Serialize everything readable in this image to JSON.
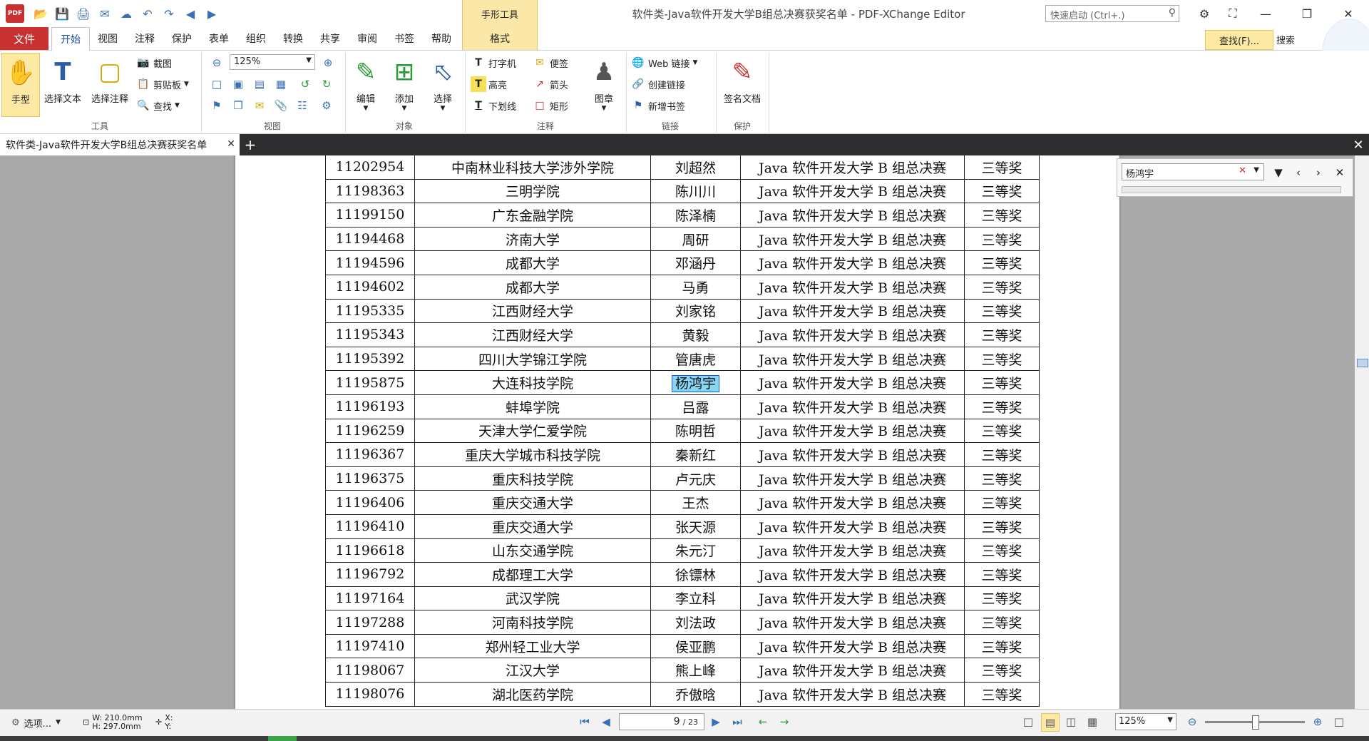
{
  "window": {
    "title": "软件类-Java软件开发大学B组总决赛获奖名单 - PDF-XChange Editor",
    "app_logo_text": "PDF",
    "quick_search_placeholder": "快速启动 (Ctrl+.)"
  },
  "context_tab": {
    "title": "手形工具",
    "tab": "格式"
  },
  "menu": {
    "file": "文件",
    "items": [
      "开始",
      "视图",
      "注释",
      "保护",
      "表单",
      "组织",
      "转换",
      "共享",
      "审阅",
      "书签",
      "帮助"
    ],
    "find_button": "查找(F)...",
    "search_button": "搜索"
  },
  "ribbon": {
    "tools": {
      "hand": "手型",
      "select_text": "选择文本",
      "select_annot": "选择注释",
      "snapshot": "截图",
      "clipboard": "剪贴板",
      "find": "查找",
      "label": "工具"
    },
    "view": {
      "zoom": "125%",
      "label": "视图"
    },
    "objects": {
      "edit": "编辑",
      "add": "添加",
      "select": "选择",
      "label": "对象"
    },
    "comments": {
      "typewriter": "打字机",
      "note": "便签",
      "highlight": "高亮",
      "arrow": "箭头",
      "underline": "下划线",
      "rect": "矩形",
      "stamp": "图章",
      "label": "注释"
    },
    "links": {
      "web": "Web 链接",
      "create": "创建链接",
      "bookmark": "新增书签",
      "label": "链接"
    },
    "protect": {
      "sign": "签名文档",
      "label": "保护"
    }
  },
  "doc_tab": {
    "title": "软件类-Java软件开发大学B组总决赛获奖名单"
  },
  "find_bar": {
    "query": "杨鸿宇"
  },
  "table": {
    "highlight_row": 9,
    "rows": [
      [
        "11202954",
        "中南林业科技大学涉外学院",
        "刘超然",
        "Java 软件开发大学 B 组总决赛",
        "三等奖"
      ],
      [
        "11198363",
        "三明学院",
        "陈川川",
        "Java 软件开发大学 B 组总决赛",
        "三等奖"
      ],
      [
        "11199150",
        "广东金融学院",
        "陈泽楠",
        "Java 软件开发大学 B 组总决赛",
        "三等奖"
      ],
      [
        "11194468",
        "济南大学",
        "周研",
        "Java 软件开发大学 B 组总决赛",
        "三等奖"
      ],
      [
        "11194596",
        "成都大学",
        "邓涵丹",
        "Java 软件开发大学 B 组总决赛",
        "三等奖"
      ],
      [
        "11194602",
        "成都大学",
        "马勇",
        "Java 软件开发大学 B 组总决赛",
        "三等奖"
      ],
      [
        "11195335",
        "江西财经大学",
        "刘家铭",
        "Java 软件开发大学 B 组总决赛",
        "三等奖"
      ],
      [
        "11195343",
        "江西财经大学",
        "黄毅",
        "Java 软件开发大学 B 组总决赛",
        "三等奖"
      ],
      [
        "11195392",
        "四川大学锦江学院",
        "管唐虎",
        "Java 软件开发大学 B 组总决赛",
        "三等奖"
      ],
      [
        "11195875",
        "大连科技学院",
        "杨鸿宇",
        "Java 软件开发大学 B 组总决赛",
        "三等奖"
      ],
      [
        "11196193",
        "蚌埠学院",
        "吕露",
        "Java 软件开发大学 B 组总决赛",
        "三等奖"
      ],
      [
        "11196259",
        "天津大学仁爱学院",
        "陈明哲",
        "Java 软件开发大学 B 组总决赛",
        "三等奖"
      ],
      [
        "11196367",
        "重庆大学城市科技学院",
        "秦新红",
        "Java 软件开发大学 B 组总决赛",
        "三等奖"
      ],
      [
        "11196375",
        "重庆科技学院",
        "卢元庆",
        "Java 软件开发大学 B 组总决赛",
        "三等奖"
      ],
      [
        "11196406",
        "重庆交通大学",
        "王杰",
        "Java 软件开发大学 B 组总决赛",
        "三等奖"
      ],
      [
        "11196410",
        "重庆交通大学",
        "张天源",
        "Java 软件开发大学 B 组总决赛",
        "三等奖"
      ],
      [
        "11196618",
        "山东交通学院",
        "朱元汀",
        "Java 软件开发大学 B 组总决赛",
        "三等奖"
      ],
      [
        "11196792",
        "成都理工大学",
        "徐镖林",
        "Java 软件开发大学 B 组总决赛",
        "三等奖"
      ],
      [
        "11197164",
        "武汉学院",
        "李立科",
        "Java 软件开发大学 B 组总决赛",
        "三等奖"
      ],
      [
        "11197288",
        "河南科技学院",
        "刘法政",
        "Java 软件开发大学 B 组总决赛",
        "三等奖"
      ],
      [
        "11197410",
        "郑州轻工业大学",
        "侯亚鹏",
        "Java 软件开发大学 B 组总决赛",
        "三等奖"
      ],
      [
        "11198067",
        "江汉大学",
        "熊上峰",
        "Java 软件开发大学 B 组总决赛",
        "三等奖"
      ],
      [
        "11198076",
        "湖北医药学院",
        "乔傲晗",
        "Java 软件开发大学 B 组总决赛",
        "三等奖"
      ]
    ]
  },
  "status": {
    "options": "选项...",
    "width": "W: 210.0mm",
    "height": "H: 297.0mm",
    "x": "X:",
    "y": "Y:",
    "page": "9",
    "page_total": "/ 23",
    "zoom": "125%"
  },
  "colors": {
    "accent_red": "#c8312f",
    "context_yellow": "#fde9a3",
    "highlight": "#86d7f5"
  }
}
